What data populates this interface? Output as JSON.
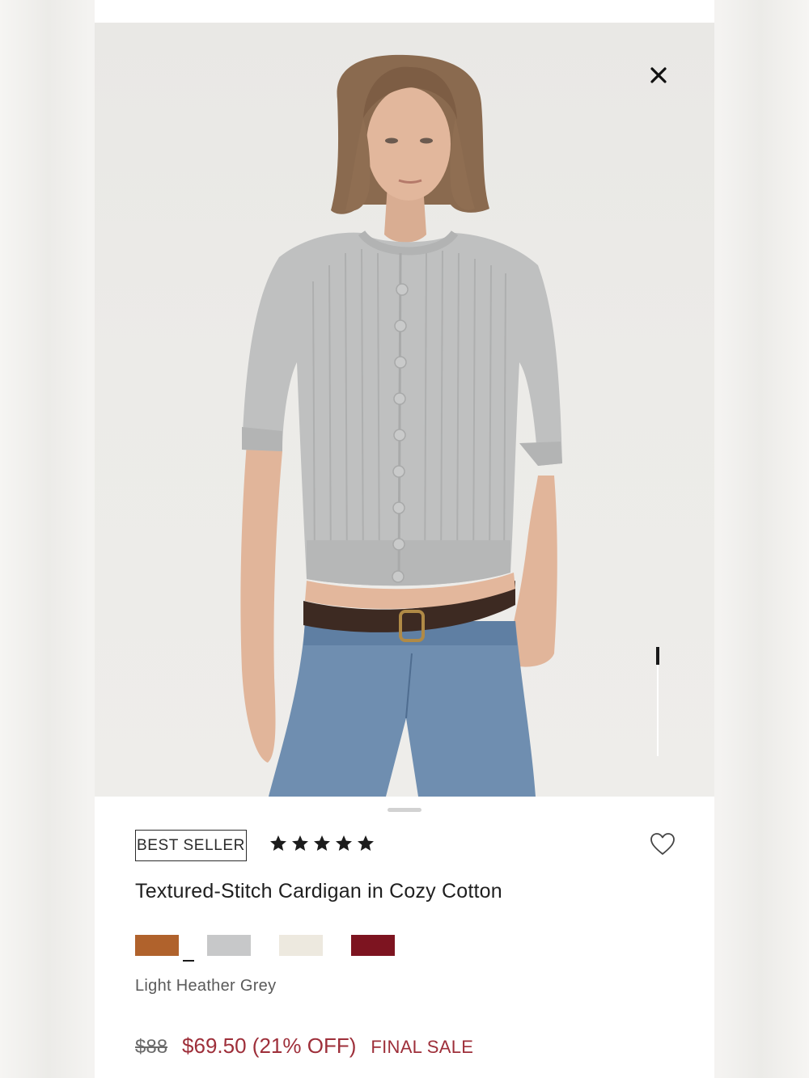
{
  "product": {
    "badge": "BEST SELLER",
    "rating_stars": 5,
    "title": "Textured-Stitch Cardigan in Cozy Cotton",
    "selected_color": "Light Heather Grey",
    "swatches": [
      {
        "name": "rust-brown",
        "color": "#b0622c"
      },
      {
        "name": "light-heather-grey",
        "color": "#c7c8c9",
        "selected": true
      },
      {
        "name": "ivory",
        "color": "#ede9df"
      },
      {
        "name": "burgundy",
        "color": "#7d1420"
      }
    ],
    "price": {
      "original": "$88",
      "sale": "$69.50 (21% OFF)",
      "note": "FINAL SALE"
    }
  },
  "icons": {
    "close": "close-icon",
    "favorite": "heart-icon",
    "star": "star-icon"
  },
  "colors": {
    "sale_red": "#9e2f3a",
    "text_dark": "#1f1f1f",
    "photo_background": "#ecebe8"
  }
}
